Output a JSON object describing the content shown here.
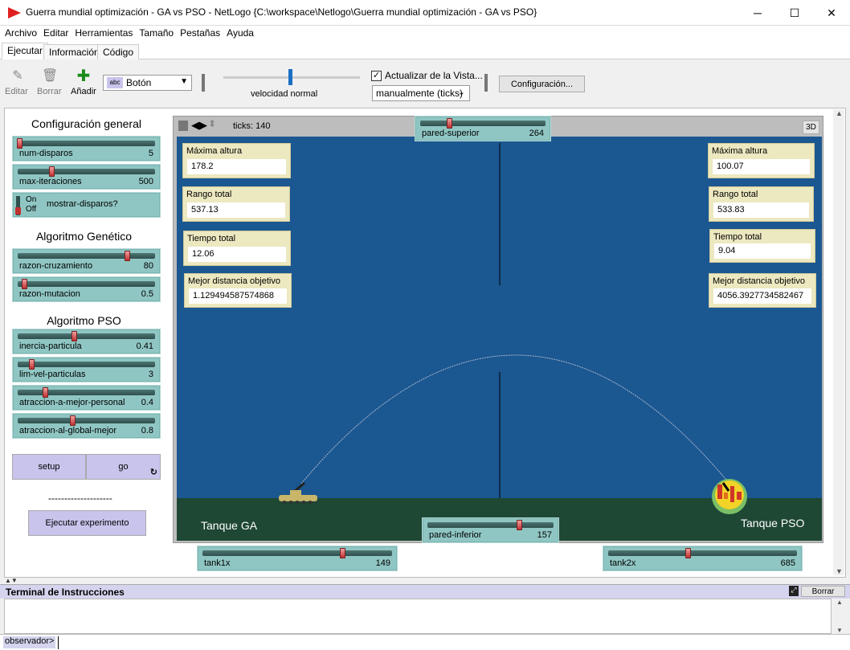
{
  "window": {
    "title": "Guerra mundial optimización - GA vs PSO - NetLogo {C:\\workspace\\Netlogo\\Guerra mundial optimización - GA vs PSO}"
  },
  "menu": [
    "Archivo",
    "Editar",
    "Herramientas",
    "Tamaño",
    "Pestañas",
    "Ayuda"
  ],
  "tabs": [
    "Ejecutar",
    "Información",
    "Código"
  ],
  "toolbar": {
    "edit": "Editar",
    "delete": "Borrar",
    "add": "Añadir",
    "widget_type": "Botón",
    "speed_label": "velocidad normal",
    "update_view": "Actualizar de la Vista...",
    "update_mode": "manualmente (ticks)",
    "settings": "Configuración..."
  },
  "panel": {
    "general_title": "Configuración general",
    "num_disparos": {
      "label": "num-disparos",
      "value": "5"
    },
    "max_iteraciones": {
      "label": "max-iteraciones",
      "value": "500"
    },
    "switch": {
      "on": "On",
      "off": "Off",
      "label": "mostrar-disparos?"
    },
    "ga_title": "Algoritmo Genético",
    "razon_cruzamiento": {
      "label": "razon-cruzamiento",
      "value": "80"
    },
    "razon_mutacion": {
      "label": "razon-mutacion",
      "value": "0.5"
    },
    "pso_title": "Algoritmo PSO",
    "inercia": {
      "label": "inercia-particula",
      "value": "0.41"
    },
    "lim_vel": {
      "label": "lim-vel-particulas",
      "value": "3"
    },
    "atraccion_personal": {
      "label": "atraccion-a-mejor-personal",
      "value": "0.4"
    },
    "atraccion_global": {
      "label": "atraccion-al-global-mejor",
      "value": "0.8"
    },
    "setup": "setup",
    "go": "go",
    "divider": "--------------------",
    "run_experiment": "Ejecutar experimento"
  },
  "view": {
    "ticks": "ticks: 140",
    "btn3d": "3D",
    "pared_superior": {
      "label": "pared-superior",
      "value": "264"
    },
    "pared_inferior": {
      "label": "pared-inferior",
      "value": "157"
    },
    "tank1x": {
      "label": "tank1x",
      "value": "149"
    },
    "tank2x": {
      "label": "tank2x",
      "value": "685"
    },
    "left": {
      "max_altura": {
        "label": "Máxima altura",
        "value": "178.2"
      },
      "rango": {
        "label": "Rango total",
        "value": "537.13"
      },
      "tiempo": {
        "label": "Tiempo total",
        "value": "12.06"
      },
      "mejor": {
        "label": "Mejor distancia objetivo",
        "value": "1.129494587574868"
      }
    },
    "right": {
      "max_altura": {
        "label": "Máxima altura",
        "value": "100.07"
      },
      "rango": {
        "label": "Rango total",
        "value": "533.83"
      },
      "tiempo": {
        "label": "Tiempo total",
        "value": "9.04"
      },
      "mejor": {
        "label": "Mejor distancia objetivo",
        "value": "4056.3927734582467"
      }
    },
    "tank_ga": "Tanque GA",
    "tank_pso": "Tanque PSO"
  },
  "command": {
    "title": "Terminal de Instrucciones",
    "clear": "Borrar",
    "prompt": "observador>"
  },
  "colors": {
    "world": "#1b5791",
    "ground": "#1e4734",
    "slider": "#8fc6c3",
    "monitor": "#ece8c0",
    "button": "#c8c4ec"
  }
}
